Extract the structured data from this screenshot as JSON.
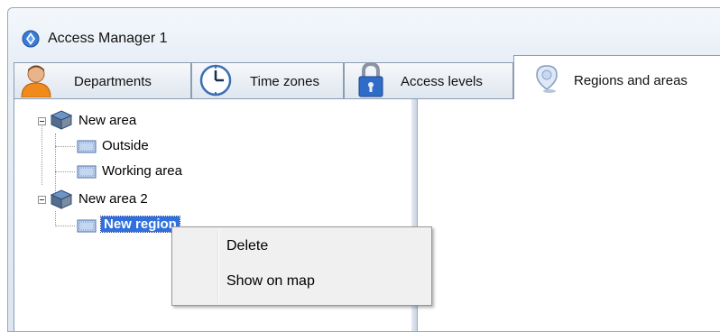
{
  "window": {
    "title": "Access Manager 1"
  },
  "tabs": [
    {
      "label": "Departments",
      "icon": "person-icon",
      "active": false
    },
    {
      "label": "Time zones",
      "icon": "clock-icon",
      "active": false
    },
    {
      "label": "Access levels",
      "icon": "lock-icon",
      "active": false
    },
    {
      "label": "Regions and areas",
      "icon": "map-pin-icon",
      "active": true
    }
  ],
  "tree": {
    "areas": [
      {
        "label": "New area",
        "expanded": true,
        "icon": "area-cube-icon",
        "regions": [
          {
            "label": "Outside"
          },
          {
            "label": "Working area"
          }
        ]
      },
      {
        "label": "New area 2",
        "expanded": true,
        "icon": "area-cube-icon",
        "regions": [
          {
            "label": "New region",
            "selected": true
          }
        ]
      }
    ]
  },
  "context_menu": {
    "items": [
      {
        "label": "Delete"
      },
      {
        "label": "Show on map"
      }
    ]
  },
  "colors": {
    "selection": "#2f6fde",
    "window_border": "#9aa9bd",
    "menu_background": "#f0f0f0"
  }
}
